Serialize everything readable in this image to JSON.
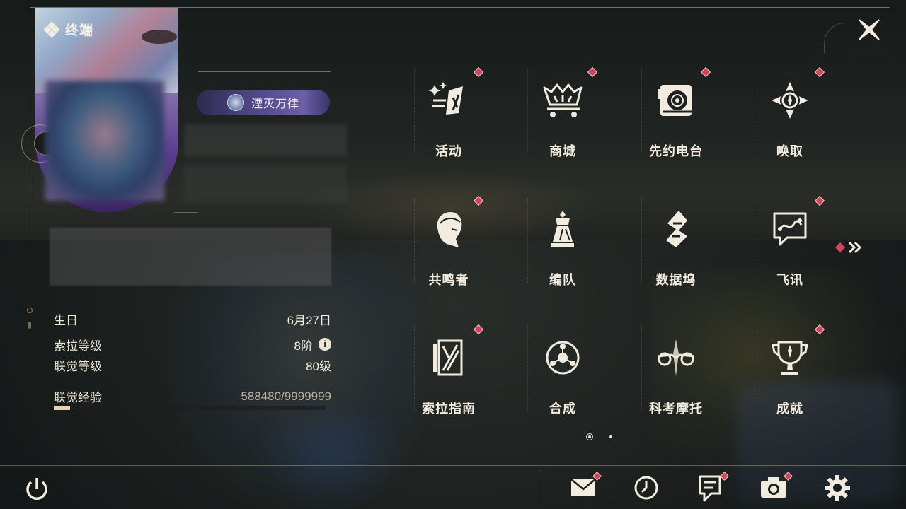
{
  "window": {
    "title": "终端"
  },
  "profile": {
    "title_badge": "湮灭万律",
    "name_blurred": "",
    "stats": [
      {
        "label": "生日",
        "value": "6月27日"
      },
      {
        "label": "索拉等级",
        "value": "8阶"
      },
      {
        "label": "联觉等级",
        "value": "80级"
      }
    ],
    "exp": {
      "label": "联觉经验",
      "value": "588480/9999999",
      "progress": 0.0589
    }
  },
  "menu": {
    "items": [
      {
        "label": "活动",
        "icon": "activity-icon",
        "has_dot": true
      },
      {
        "label": "商城",
        "icon": "shop-cart-icon",
        "has_dot": true
      },
      {
        "label": "先约电台",
        "icon": "radio-icon",
        "has_dot": true
      },
      {
        "label": "唤取",
        "icon": "convene-icon",
        "has_dot": true
      },
      {
        "label": "共鸣者",
        "icon": "resonator-icon",
        "has_dot": true
      },
      {
        "label": "编队",
        "icon": "team-icon",
        "has_dot": false
      },
      {
        "label": "数据坞",
        "icon": "data-bank-icon",
        "has_dot": false
      },
      {
        "label": "飞讯",
        "icon": "message-icon",
        "has_dot": true
      },
      {
        "label": "索拉指南",
        "icon": "guidebook-icon",
        "has_dot": true
      },
      {
        "label": "合成",
        "icon": "synthesis-icon",
        "has_dot": false
      },
      {
        "label": "科考摩托",
        "icon": "motorcycle-icon",
        "has_dot": false
      },
      {
        "label": "成就",
        "icon": "trophy-icon",
        "has_dot": true
      }
    ],
    "pagination": {
      "current": 1,
      "total": 2
    }
  },
  "bottom_bar": {
    "tools": [
      {
        "icon": "mail-icon",
        "has_dot": true
      },
      {
        "icon": "clock-icon",
        "has_dot": false
      },
      {
        "icon": "notice-icon",
        "has_dot": true
      },
      {
        "icon": "camera-icon",
        "has_dot": true
      },
      {
        "icon": "settings-gear-icon",
        "has_dot": false
      }
    ]
  },
  "colors": {
    "accent_dot": "#d0455a",
    "text_primary": "#f2ecdf",
    "badge_purple": "#4e4683"
  }
}
